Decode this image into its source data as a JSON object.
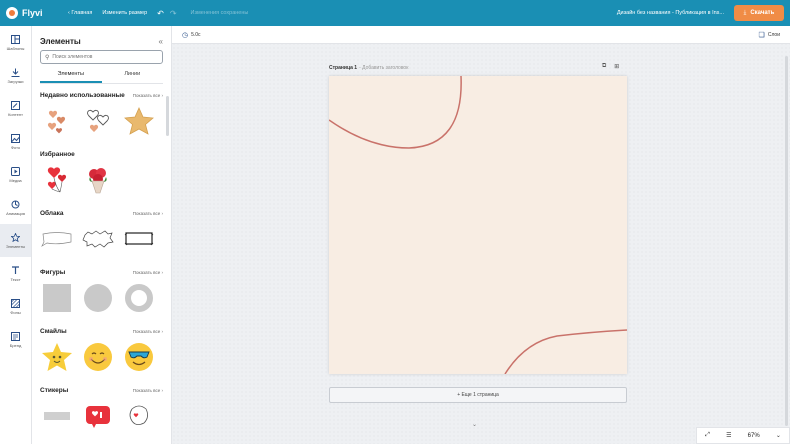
{
  "topbar": {
    "app_name": "Flyvi",
    "home_link": "Главная",
    "resize_link": "Изменить размер",
    "undo_icon": "undo-icon",
    "redo_icon": "redo-icon",
    "status": "Изменения сохранены",
    "document_name": "Дизайн без названия - Публикация в Ins...",
    "save_button": "Скачать",
    "save_icon": "download-icon"
  },
  "rail": {
    "items": [
      {
        "label": "Шаблоны",
        "icon": "templates-icon"
      },
      {
        "label": "Загрузки",
        "icon": "upload-icon"
      },
      {
        "label": "Контент",
        "icon": "content-icon"
      },
      {
        "label": "Фото",
        "icon": "photo-icon"
      },
      {
        "label": "Медиа",
        "icon": "media-icon"
      },
      {
        "label": "Анимация",
        "icon": "animation-icon"
      },
      {
        "label": "Элементы",
        "icon": "star-icon"
      },
      {
        "label": "Текст",
        "icon": "text-icon"
      },
      {
        "label": "Фоны",
        "icon": "backgrounds-icon"
      },
      {
        "label": "Бренд",
        "icon": "brand-icon"
      }
    ],
    "active_index": 6
  },
  "panel": {
    "title": "Элементы",
    "search_placeholder": "Поиск элементов",
    "tabs": [
      "Элементы",
      "Линии"
    ],
    "active_tab": 0,
    "sections": [
      {
        "title": "Недавно использованные",
        "show_all": "Показать все"
      },
      {
        "title": "Избранное",
        "show_all": ""
      },
      {
        "title": "Облака",
        "show_all": "Показать все"
      },
      {
        "title": "Фигуры",
        "show_all": "Показать все"
      },
      {
        "title": "Смайлы",
        "show_all": "Показать все"
      },
      {
        "title": "Стикеры",
        "show_all": "Показать все"
      }
    ]
  },
  "workspace": {
    "animation_label": "5.0с",
    "layers_label": "Слои",
    "page_title": "Страница 1",
    "page_subtitle": "- Добавить заголовок",
    "add_page": "+ Еще 1 страница",
    "zoom": "67%"
  },
  "colors": {
    "topbar": "#1a8fb4",
    "accent": "#f08c46",
    "canvas_bg": "#f8ede3",
    "canvas_curve": "#c9726a"
  }
}
